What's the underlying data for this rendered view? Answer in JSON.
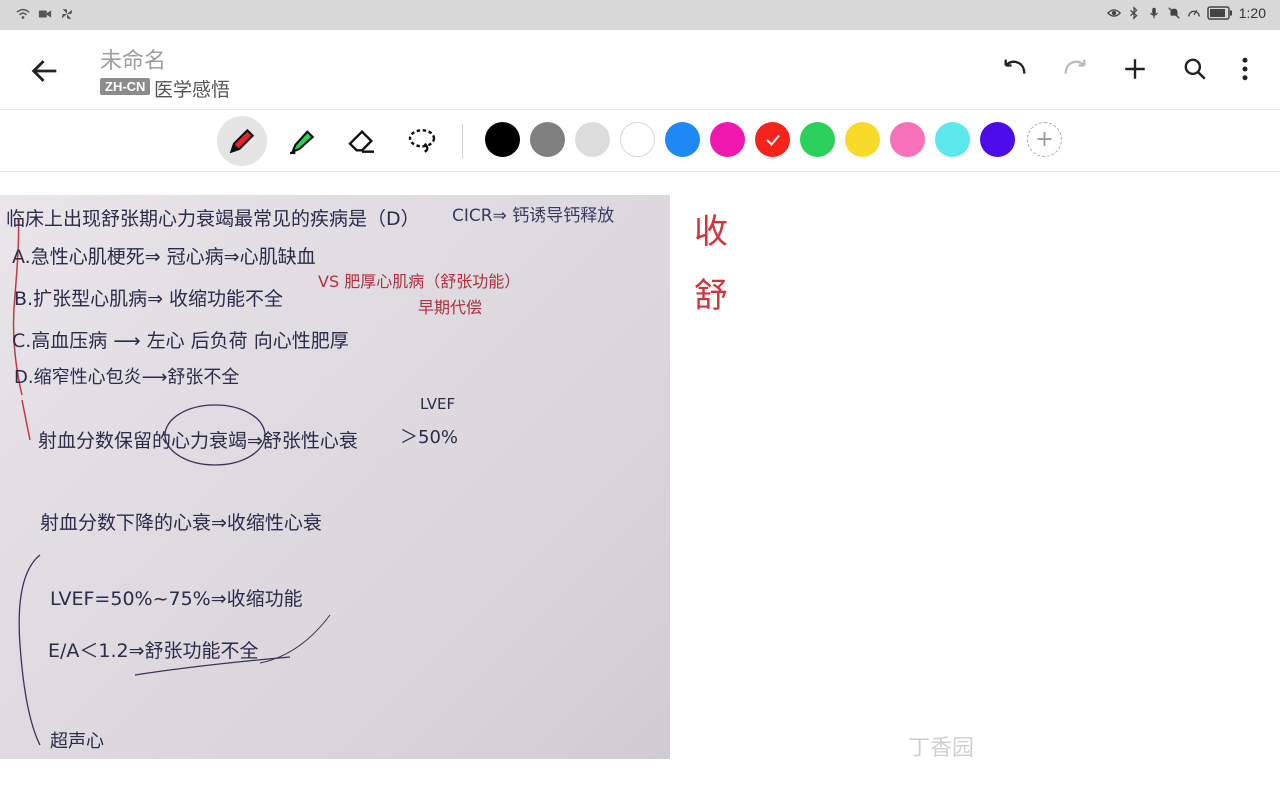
{
  "status_bar": {
    "time": "1:20",
    "left_icons": [
      "wifi-icon",
      "video-icon",
      "pinwheel-icon"
    ],
    "right_icons": [
      "eye-icon",
      "bluetooth-icon",
      "mic-icon",
      "bell-off-icon",
      "speed-icon",
      "battery-icon"
    ]
  },
  "header": {
    "title": "未命名",
    "language_badge": "ZH-CN",
    "subtitle": "医学感悟"
  },
  "toolbar": {
    "tools": [
      "pen-icon",
      "highlighter-icon",
      "eraser-icon",
      "lasso-icon"
    ],
    "active_tool": "pen-icon",
    "colors": [
      "#000000",
      "#808080",
      "#dcdcdc",
      "#ffffff",
      "#1e88f5",
      "#f118b0",
      "#f5231b",
      "#2ad05a",
      "#f7da2a",
      "#f772b8",
      "#5be9ec",
      "#4a0ce8"
    ],
    "selected_color": "#f5231b"
  },
  "note": {
    "annotations": [
      "收",
      "舒"
    ],
    "photo_lines": [
      "临床上出现舒张期心力衰竭最常见的疾病是（D）",
      "CICR⇒ 钙诱导钙释放",
      "A.急性心肌梗死⇒ 冠心病⇒心肌缺血",
      "B.扩张型心肌病⇒ 收缩功能不全",
      "VS 肥厚心肌病（舒张功能）",
      "早期代偿",
      "C.高血压病 ⟶ 左心 后负荷 向心性肥厚",
      "D.缩窄性心包炎⟶舒张不全",
      "LVEF",
      "射血分数保留的心力衰竭⇒舒张性心衰",
      "＞50%",
      "射血分数下降的心衰⇒收缩性心衰",
      "LVEF=50%~75%⇒收缩功能",
      "E/A＜1.2⇒舒张功能不全",
      "超声心"
    ],
    "watermark": "丁香园"
  }
}
